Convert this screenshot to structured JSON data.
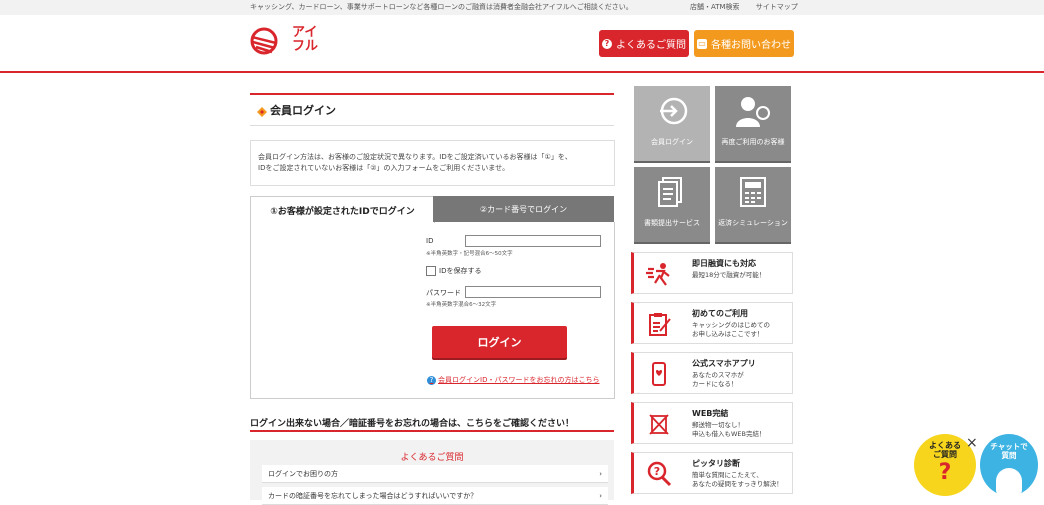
{
  "top": {
    "notice": "キャッシング、カードローン、事業サポートローンなど各種ローンのご融資は消費者金融会社アイフルへご相談ください。",
    "links": [
      "店舗・ATM検索",
      "サイトマップ"
    ]
  },
  "header": {
    "logo_text": "アイフル",
    "faq_label": "よくあるご質問",
    "contact_label": "各種お問い合わせ",
    "accent": "#d9262c",
    "contact_color": "#f39a1e"
  },
  "main": {
    "title": "会員ログイン",
    "intro_line1": "会員ログイン方法は、お客様のご設定状況で異なります。IDをご設定済いているお客様は「①」を、",
    "intro_line2": "IDをご設定されていないお客様は「②」の入力フォームをご利用くださいませ。",
    "tab_id": "①お客様が設定されたIDでログイン",
    "tab_card": "②カード番号でログイン",
    "id_label": "ID",
    "id_hint": "※半角英数字・記号混合6〜50文字",
    "save_label": "IDを保存する",
    "pw_label": "パスワード",
    "pw_hint": "※半角英数字混合6〜32文字",
    "login_button": "ログイン",
    "forgot_link": "会員ログインID・パスワードをお忘れの方はこちら",
    "trouble_title": "ログイン出来ない場合／暗証番号をお忘れの場合は、こちらをご確認ください！",
    "faq_heading": "よくあるご質問",
    "faq_items": [
      "ログインでお困りの方",
      "カードの暗証番号を忘れてしまった場合はどうすればいいですか？"
    ]
  },
  "sidebar": {
    "tiles": [
      {
        "label": "会員ログイン",
        "icon": "login-arrow-icon"
      },
      {
        "label": "再度ご利用のお客様",
        "icon": "user-refresh-icon"
      },
      {
        "label": "書類提出サービス",
        "icon": "documents-icon"
      },
      {
        "label": "返済シミュレーション",
        "icon": "calculator-icon"
      }
    ],
    "promos": [
      {
        "title": "即日融資にも対応",
        "desc1": "最短18分で融資が可能！",
        "desc2": "",
        "icon": "running-man-icon"
      },
      {
        "title": "初めてのご利用",
        "desc1": "キャッシングのはじめての",
        "desc2": "お申し込みはここです！",
        "icon": "clipboard-check-icon"
      },
      {
        "title": "公式スマホアプリ",
        "desc1": "あなたのスマホが",
        "desc2": "カードになる！",
        "icon": "smartphone-icon"
      },
      {
        "title": "WEB完結",
        "desc1": "郵送物一切なし！",
        "desc2": "申込も借入もWEB完結！",
        "icon": "no-mail-icon"
      },
      {
        "title": "ピッタリ診断",
        "desc1": "簡単な質問にこたえて、",
        "desc2": "あなたの疑問をすっきり解決！",
        "icon": "magnifier-question-icon"
      }
    ]
  },
  "floating": {
    "faq_line1": "よくある",
    "faq_line2": "ご質問",
    "faq_mark": "?",
    "close": "×",
    "chat_line1": "チャットで",
    "chat_line2": "質問"
  }
}
